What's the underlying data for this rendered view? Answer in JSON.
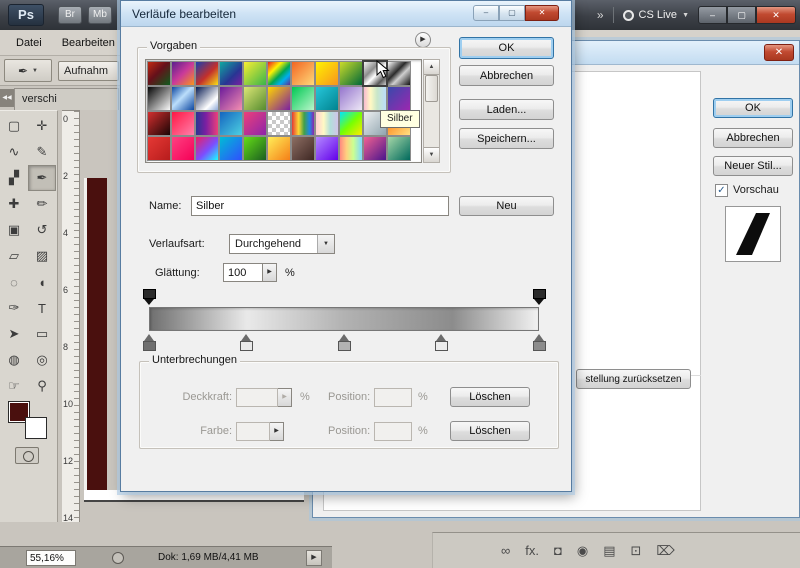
{
  "app": {
    "logo": "Ps",
    "top_buttons": [
      "Br",
      "Mb"
    ],
    "overflow": "»",
    "cs_live": "CS Live",
    "menus": [
      "Datei",
      "Bearbeiten"
    ],
    "options_button": "Aufnahm",
    "doc_tab": "verschi",
    "collapse_arrows": "◀◀",
    "foreground_color": "#4a100e",
    "background_color": "#ffffff",
    "window_controls": {
      "minimize": "–",
      "maximize": "▢",
      "close": "✕"
    },
    "tools": {
      "selected_index": 5,
      "items": [
        {
          "name": "rectangular-marquee-tool",
          "glyph": "▢"
        },
        {
          "name": "move-tool",
          "glyph": "✛"
        },
        {
          "name": "lasso-tool",
          "glyph": "∿"
        },
        {
          "name": "quick-selection-tool",
          "glyph": "✎"
        },
        {
          "name": "crop-tool",
          "glyph": "▞"
        },
        {
          "name": "eyedropper-tool",
          "glyph": "✒"
        },
        {
          "name": "healing-brush-tool",
          "glyph": "✚"
        },
        {
          "name": "brush-tool",
          "glyph": "✏"
        },
        {
          "name": "clone-stamp-tool",
          "glyph": "▣"
        },
        {
          "name": "history-brush-tool",
          "glyph": "↺"
        },
        {
          "name": "eraser-tool",
          "glyph": "▱"
        },
        {
          "name": "gradient-tool",
          "glyph": "▨"
        },
        {
          "name": "blur-tool",
          "glyph": "◌"
        },
        {
          "name": "dodge-tool",
          "glyph": "◖"
        },
        {
          "name": "pen-tool",
          "glyph": "✑"
        },
        {
          "name": "type-tool",
          "glyph": "T"
        },
        {
          "name": "path-selection-tool",
          "glyph": "➤"
        },
        {
          "name": "shape-tool",
          "glyph": "▭"
        },
        {
          "name": "3d-rotate-tool",
          "glyph": "◍"
        },
        {
          "name": "3d-orbit-tool",
          "glyph": "◎"
        },
        {
          "name": "hand-tool",
          "glyph": "☞"
        },
        {
          "name": "zoom-tool",
          "glyph": "⚲"
        }
      ]
    }
  },
  "ruler": {
    "numbers": [
      "0",
      "2",
      "4",
      "6",
      "8",
      "10",
      "12",
      "14"
    ]
  },
  "status_bar": {
    "zoom": "55,16%",
    "doc_info": "Dok: 1,69 MB/4,41 MB",
    "expand": "▶"
  },
  "layers_bar": {
    "icons": [
      {
        "name": "link-layers-icon",
        "glyph": "∞"
      },
      {
        "name": "layer-effects-icon",
        "glyph": "fx."
      },
      {
        "name": "layer-mask-icon",
        "glyph": "◘"
      },
      {
        "name": "adjustment-layer-icon",
        "glyph": "◉"
      },
      {
        "name": "layer-group-icon",
        "glyph": "▤"
      },
      {
        "name": "new-layer-icon",
        "glyph": "⊡"
      },
      {
        "name": "delete-layer-icon",
        "glyph": "⌦"
      }
    ]
  },
  "gradient_dialog": {
    "title": "Verläufe bearbeiten",
    "icons": {
      "flyout": "▶",
      "combo_caret": "▼",
      "spinner": "▶",
      "color_flyout": "▶",
      "scroll_up": "▲",
      "scroll_down": "▼"
    },
    "presets": {
      "label": "Vorgaben",
      "tooltip": "Silber",
      "hover_index": 9,
      "swatches": [
        "linear-gradient(135deg,#c22a12,#65101a 45%,#0f5c1e)",
        "linear-gradient(135deg,#5a1f8e,#c93a9a 50%,#f7941d)",
        "linear-gradient(135deg,#1c3fae,#c4302b 55%,#f7e017)",
        "linear-gradient(135deg,#11a8a0,#283593 60%,#7b1fa2)",
        "linear-gradient(135deg,#f9ed32,#39b54a)",
        "linear-gradient(135deg,#ed1c24,#fff200 30%,#00a651 55%,#00aeef 75%,#662d91)",
        "linear-gradient(135deg,#f26522,#ffd97a)",
        "linear-gradient(135deg,#fff200,#f7941d)",
        "linear-gradient(135deg,#cbdb2a,#006838)",
        "linear-gradient(135deg,#f5f5f5,#8c8c8c 35%,#ffffff 55%,#5a5a5a 80%,#cccccc)",
        "linear-gradient(135deg,#ffffff,#2b2b2b 40%,#cfcfcf 60%,#111111)",
        "linear-gradient(135deg,#050505,#fafafa)",
        "linear-gradient(135deg,#0d47a1,#bbdefb 45%,#0d47a1)",
        "linear-gradient(135deg,#061a52,#ffffff 70%,#8da9d8)",
        "linear-gradient(135deg,#6a1b9a,#f48fb1)",
        "linear-gradient(135deg,#dce775,#558b2f)",
        "linear-gradient(135deg,#ffd600,#7b1fa2)",
        "linear-gradient(135deg,#00c853,#b9f6ca)",
        "linear-gradient(135deg,#26c6da,#00838f)",
        "linear-gradient(135deg,#9575cd,#ede7f6)",
        "linear-gradient(90deg,#f8bbd0,#fff9c4 30%,#c8e6c9 60%,#bbdefb)",
        "linear-gradient(135deg,#3949ab,#9c27b0)",
        "linear-gradient(135deg,#d32f2f,#1a0505)",
        "linear-gradient(135deg,#ff1744,#ff80ab)",
        "linear-gradient(90deg,#283593,#7b1fa2 45%,#ec407a)",
        "linear-gradient(135deg,#1565c0,#4dd0e1)",
        "linear-gradient(135deg,#ec407a,#8e24aa)",
        "repeating-conic-gradient(#c9c9c9 0% 25%, #ffffff 0% 50%) 0 0 / 8px 8px",
        "linear-gradient(90deg,#e53935,#fdd835 30%,#43a047 55%,#1e88e5 80%,#8e24aa)",
        "linear-gradient(90deg,#ffcdd2,#fff9c4 35%,#b2dfdb 65%,#d1c4e9)",
        "linear-gradient(135deg,#00e5ff,#76ff03 50%,#ffea00)",
        "linear-gradient(135deg,#eceff1,#90a4ae)",
        "linear-gradient(135deg,#ff6f00,#ffe082)",
        "linear-gradient(135deg,#e53935,#b71c1c)",
        "linear-gradient(135deg,#ff4081,#f50057)",
        "linear-gradient(135deg,#e91e63,#7c4dff 55%,#18ffff)",
        "linear-gradient(135deg,#00bcd4,#304ffe)",
        "linear-gradient(135deg,#64dd17,#1b5e20)",
        "linear-gradient(135deg,#ffee58,#f57f17)",
        "linear-gradient(135deg,#8d6e63,#3e2723)",
        "linear-gradient(135deg,#b388ff,#6200ea)",
        "linear-gradient(90deg,#ff8a80,#ffd180 30%,#ccff90 60%,#80d8ff)",
        "linear-gradient(135deg,#f06292,#4a148c)",
        "linear-gradient(135deg,#a5d6a7,#00695c)"
      ]
    },
    "buttons": {
      "ok": "OK",
      "cancel": "Abbrechen",
      "load": "Laden...",
      "save": "Speichern..."
    },
    "name_row": {
      "label": "Name:",
      "value": "Silber",
      "new": "Neu"
    },
    "type_row": {
      "label": "Verlaufsart:",
      "value": "Durchgehend"
    },
    "smooth_row": {
      "label": "Glättung:",
      "value": "100",
      "unit": "%"
    },
    "gradient_bar": {
      "css": "linear-gradient(90deg,#6f6f6f 0%,#e9e9e9 25%,#b2b2b2 50%,#8c8c8c 78%,#f1f1f1 100%)",
      "opacity_stops": [
        0,
        100
      ],
      "color_stops": [
        {
          "pos": 0,
          "color": "#6f6f6f"
        },
        {
          "pos": 25,
          "color": "#e9e9e9"
        },
        {
          "pos": 50,
          "color": "#b2b2b2"
        },
        {
          "pos": 75,
          "color": "#ececec"
        },
        {
          "pos": 100,
          "color": "#8c8c8c"
        }
      ]
    },
    "stops_section": {
      "label": "Unterbrechungen",
      "opacity_label": "Deckkraft:",
      "color_label": "Farbe:",
      "position_label": "Position:",
      "unit": "%",
      "delete": "Löschen"
    }
  },
  "style_dialog": {
    "ok": "OK",
    "cancel": "Abbrechen",
    "new_style": "Neuer Stil...",
    "preview": "Vorschau",
    "check_glyph": "✓",
    "reset_button": "stellung zurücksetzen"
  }
}
